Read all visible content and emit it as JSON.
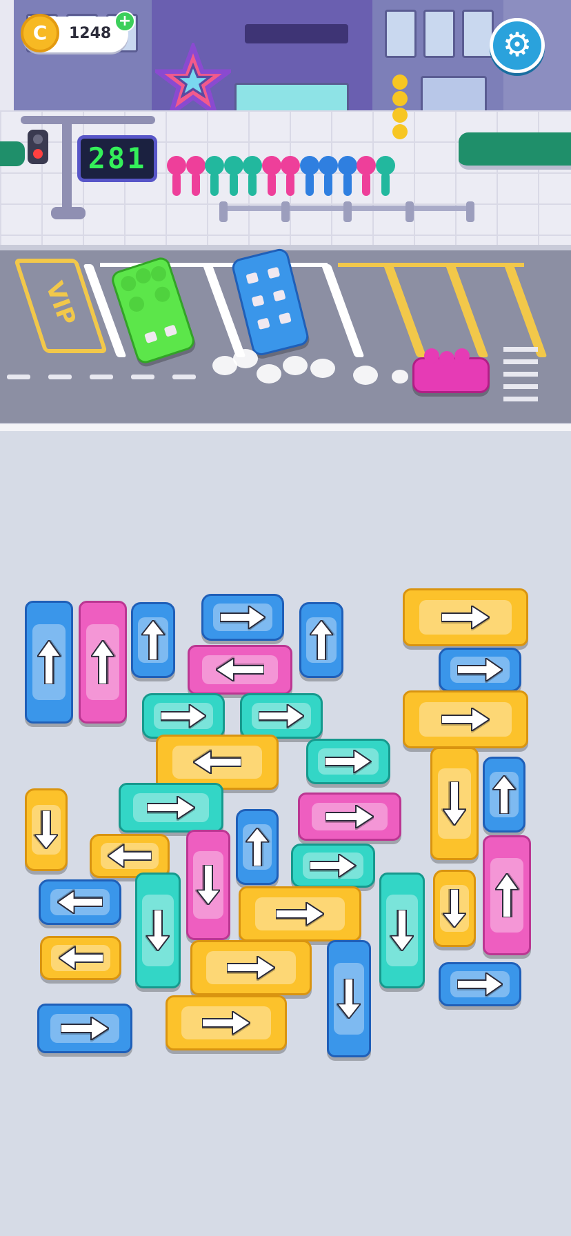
{
  "hud": {
    "coins": "1248",
    "coins_plus": "+",
    "coin_symbol": "C",
    "settings_icon": "gear-icon",
    "counter": "281"
  },
  "parking": {
    "vip_label": "VIP"
  },
  "queue_colors": [
    "#ee3f9a",
    "#ee3f9a",
    "#22b89e",
    "#22b89e",
    "#22b89e",
    "#ee3f9a",
    "#ee3f9a",
    "#2f7fe0",
    "#2f7fe0",
    "#2f7fe0",
    "#ee3f9a",
    "#22b89e"
  ],
  "vehicles": [
    {
      "color": "blue",
      "kind": "bus",
      "dir": "up"
    },
    {
      "color": "pink",
      "kind": "bus",
      "dir": "up"
    },
    {
      "color": "blue",
      "kind": "car",
      "dir": "up"
    },
    {
      "color": "blue",
      "kind": "car",
      "dir": "right"
    },
    {
      "color": "blue",
      "kind": "car",
      "dir": "up"
    },
    {
      "color": "yellow",
      "kind": "bus",
      "dir": "right"
    },
    {
      "color": "pink",
      "kind": "bus",
      "dir": "left"
    },
    {
      "color": "blue",
      "kind": "car",
      "dir": "right"
    },
    {
      "color": "teal",
      "kind": "car",
      "dir": "right"
    },
    {
      "color": "teal",
      "kind": "car",
      "dir": "right"
    },
    {
      "color": "yellow",
      "kind": "bus",
      "dir": "right"
    },
    {
      "color": "yellow",
      "kind": "bus",
      "dir": "left"
    },
    {
      "color": "teal",
      "kind": "car",
      "dir": "right"
    },
    {
      "color": "yellow",
      "kind": "bus",
      "dir": "down"
    },
    {
      "color": "blue",
      "kind": "car",
      "dir": "up"
    },
    {
      "color": "yellow",
      "kind": "car",
      "dir": "down"
    },
    {
      "color": "teal",
      "kind": "bus",
      "dir": "right"
    },
    {
      "color": "pink",
      "kind": "bus",
      "dir": "right"
    },
    {
      "color": "yellow",
      "kind": "car",
      "dir": "left"
    },
    {
      "color": "pink",
      "kind": "bus",
      "dir": "down"
    },
    {
      "color": "blue",
      "kind": "car",
      "dir": "up"
    },
    {
      "color": "teal",
      "kind": "car",
      "dir": "right"
    },
    {
      "color": "pink",
      "kind": "bus",
      "dir": "up"
    },
    {
      "color": "blue",
      "kind": "car",
      "dir": "left"
    },
    {
      "color": "teal",
      "kind": "bus",
      "dir": "down"
    },
    {
      "color": "yellow",
      "kind": "bus",
      "dir": "right"
    },
    {
      "color": "teal",
      "kind": "bus",
      "dir": "down"
    },
    {
      "color": "yellow",
      "kind": "car",
      "dir": "down"
    },
    {
      "color": "yellow",
      "kind": "car",
      "dir": "left"
    },
    {
      "color": "yellow",
      "kind": "bus",
      "dir": "right"
    },
    {
      "color": "blue",
      "kind": "bus",
      "dir": "down"
    },
    {
      "color": "blue",
      "kind": "car",
      "dir": "right"
    },
    {
      "color": "blue",
      "kind": "bus",
      "dir": "right"
    },
    {
      "color": "yellow",
      "kind": "bus",
      "dir": "right"
    }
  ]
}
